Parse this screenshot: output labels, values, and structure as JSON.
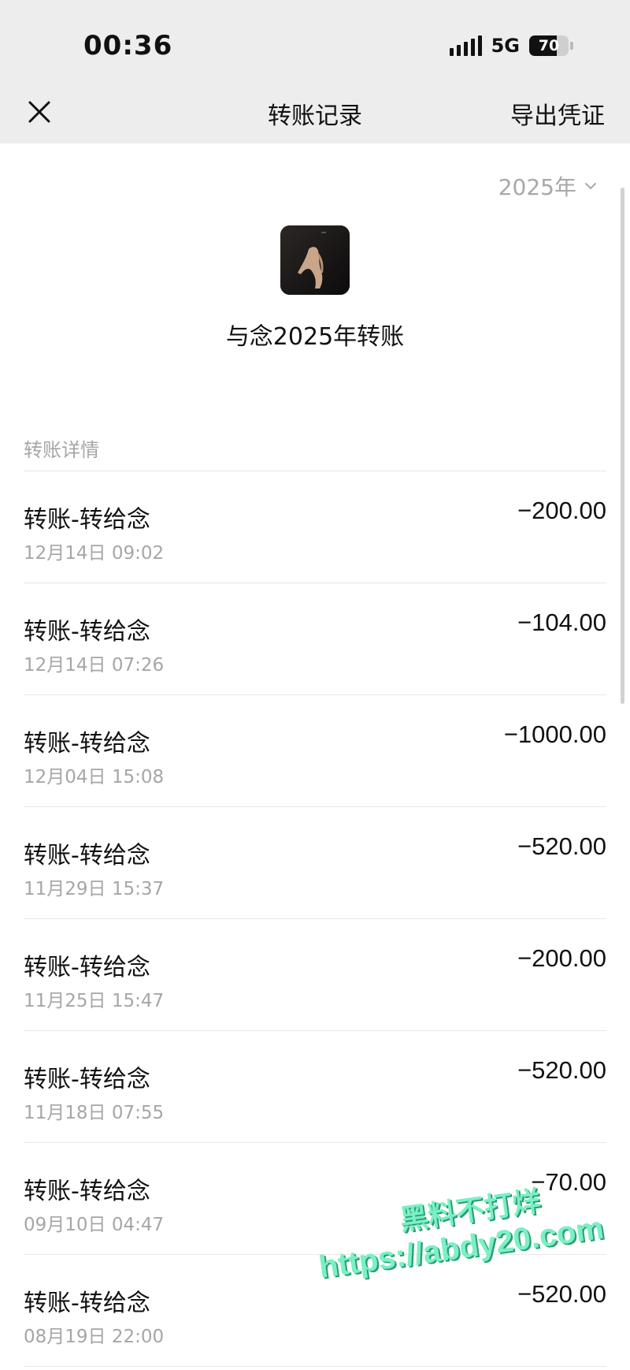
{
  "status_bar": {
    "time": "00:36",
    "network": "5G",
    "battery": "70",
    "battery_fraction": 0.7
  },
  "nav": {
    "close_icon": "close-icon",
    "title": "转账记录",
    "export_label": "导出凭证"
  },
  "filter": {
    "year": "2025年",
    "chevron_icon": "chevron-down-icon"
  },
  "summary": {
    "title": "与念2025年转账"
  },
  "section": {
    "title": "转账详情"
  },
  "transactions": [
    {
      "title": "转账-转给念",
      "time": "12月14日 09:02",
      "amount": "−200.00"
    },
    {
      "title": "转账-转给念",
      "time": "12月14日 07:26",
      "amount": "−104.00"
    },
    {
      "title": "转账-转给念",
      "time": "12月04日 15:08",
      "amount": "−1000.00"
    },
    {
      "title": "转账-转给念",
      "time": "11月29日 15:37",
      "amount": "−520.00"
    },
    {
      "title": "转账-转给念",
      "time": "11月25日 15:47",
      "amount": "−200.00"
    },
    {
      "title": "转账-转给念",
      "time": "11月18日 07:55",
      "amount": "−520.00"
    },
    {
      "title": "转账-转给念",
      "time": "09月10日 04:47",
      "amount": "−70.00"
    },
    {
      "title": "转账-转给念",
      "time": "08月19日 22:00",
      "amount": "−520.00"
    }
  ],
  "watermark": {
    "line1": "黑料不打烊",
    "line2": "https://abdy20.com"
  },
  "colors": {
    "header_bg": "#ededed",
    "muted_text": "#a6a6a6",
    "divider": "#e7e7e7",
    "watermark": "#7af0c4"
  }
}
